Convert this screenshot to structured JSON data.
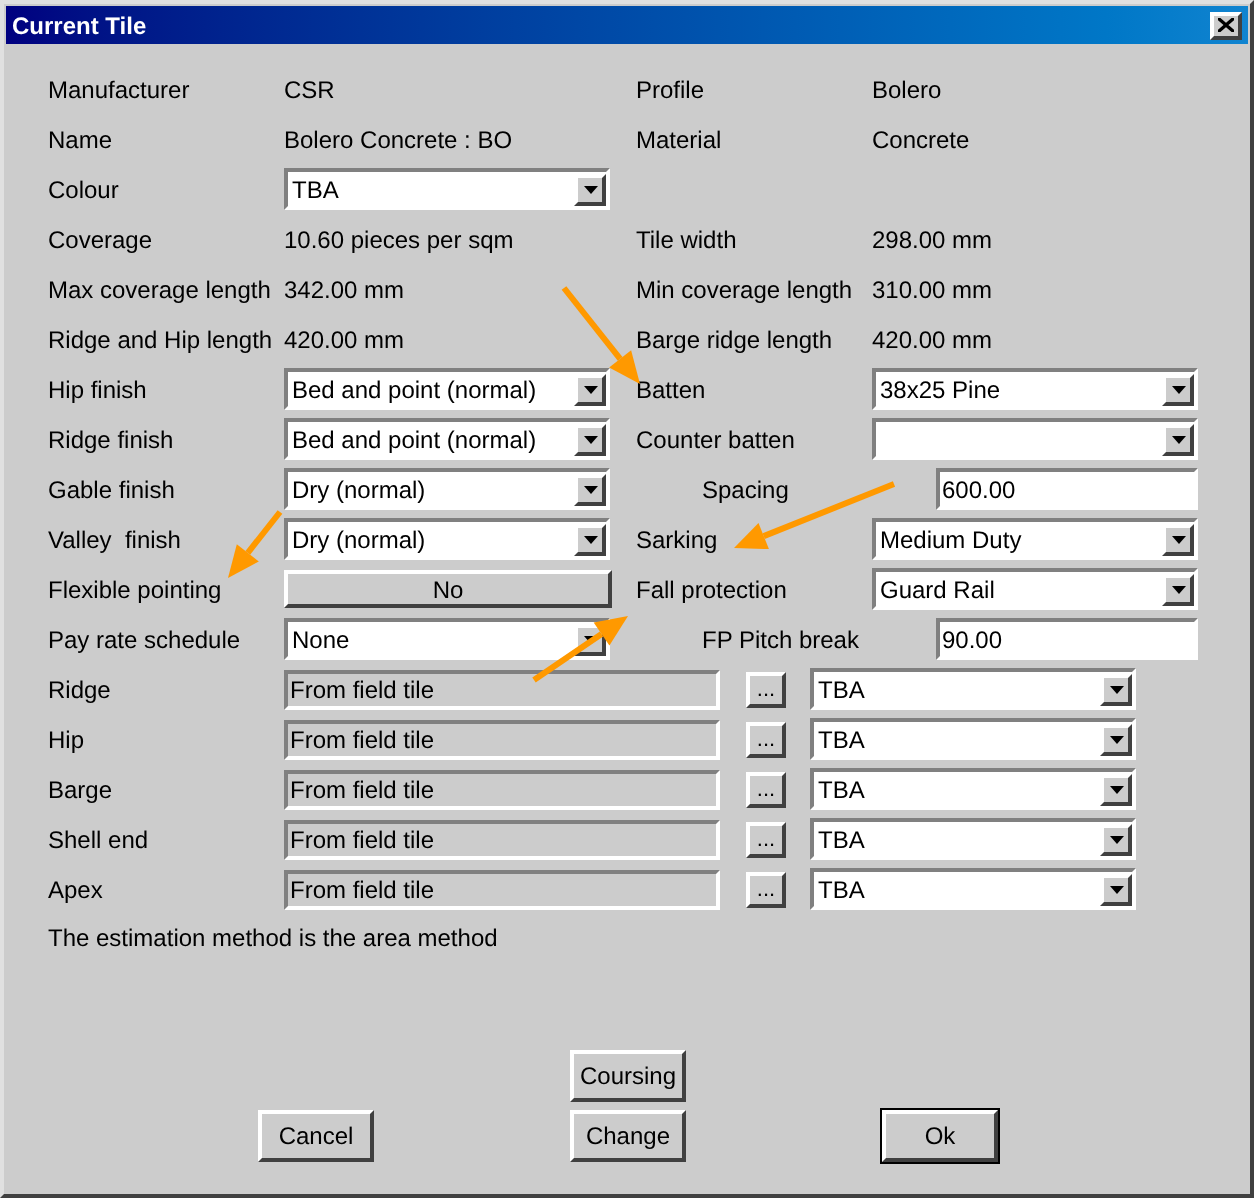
{
  "window": {
    "title": "Current Tile"
  },
  "rows": [
    {
      "left": {
        "label": "Manufacturer",
        "kind": "text",
        "value": "CSR"
      },
      "right": {
        "label": "Profile",
        "kind": "text",
        "value": "Bolero"
      }
    },
    {
      "left": {
        "label": "Name",
        "kind": "text",
        "value": "Bolero Concrete : BO"
      },
      "right": {
        "label": "Material",
        "kind": "text",
        "value": "Concrete"
      }
    },
    {
      "left": {
        "label": "Colour",
        "kind": "dropdown",
        "value": "TBA"
      }
    },
    {
      "left": {
        "label": "Coverage",
        "kind": "text",
        "value": "10.60 pieces per sqm"
      },
      "right": {
        "label": "Tile width",
        "kind": "text",
        "value": "298.00 mm"
      }
    },
    {
      "left": {
        "label": "Max coverage length",
        "kind": "text",
        "value": "342.00 mm"
      },
      "right": {
        "label": "Min coverage length",
        "kind": "text",
        "value": "310.00 mm"
      }
    },
    {
      "left": {
        "label": "Ridge and Hip length",
        "kind": "text",
        "value": "420.00 mm"
      },
      "right": {
        "label": "Barge ridge length",
        "kind": "text",
        "value": "420.00 mm"
      }
    },
    {
      "left": {
        "label": "Hip finish",
        "kind": "dropdown",
        "value": "Bed and point (normal)"
      },
      "right": {
        "label": "Batten",
        "kind": "dropdown",
        "value": "38x25 Pine"
      }
    },
    {
      "left": {
        "label": "Ridge finish",
        "kind": "dropdown",
        "value": "Bed and point (normal)"
      },
      "right": {
        "label": "Counter batten",
        "kind": "dropdown"
      }
    },
    {
      "left": {
        "label": "Gable finish",
        "kind": "dropdown",
        "value": "Dry (normal)"
      },
      "right": {
        "label": "Spacing",
        "kind": "input",
        "value": "600.00"
      }
    },
    {
      "left": {
        "label": "Valley  finish",
        "kind": "dropdown",
        "value": "Dry (normal)"
      },
      "right": {
        "label": "Sarking",
        "kind": "dropdown",
        "value": "Medium Duty"
      }
    },
    {
      "left": {
        "label": "Flexible pointing",
        "kind": "button",
        "value": "No"
      },
      "right": {
        "label": "Fall protection",
        "kind": "dropdown",
        "value": "Guard Rail"
      }
    },
    {
      "left": {
        "label": "Pay rate schedule",
        "kind": "dropdown",
        "value": "None"
      },
      "right": {
        "label": "FP Pitch break",
        "kind": "input",
        "value": "90.00"
      }
    }
  ],
  "components": [
    {
      "label": "Ridge",
      "source": "From field tile",
      "browse": "...",
      "colour": "TBA"
    },
    {
      "label": "Hip",
      "source": "From field tile",
      "browse": "...",
      "colour": "TBA"
    },
    {
      "label": "Barge",
      "source": "From field tile",
      "browse": "...",
      "colour": "TBA"
    },
    {
      "label": "Shell end",
      "source": "From field tile",
      "browse": "...",
      "colour": "TBA"
    },
    {
      "label": "Apex",
      "source": "From field tile",
      "browse": "...",
      "colour": "TBA"
    }
  ],
  "note": "The estimation method is the area method",
  "buttons": [
    {
      "label": "Coursing",
      "default": false
    },
    {
      "label": "Cancel",
      "default": false
    },
    {
      "label": "Change",
      "default": false
    },
    {
      "label": "Ok",
      "default": true
    }
  ]
}
